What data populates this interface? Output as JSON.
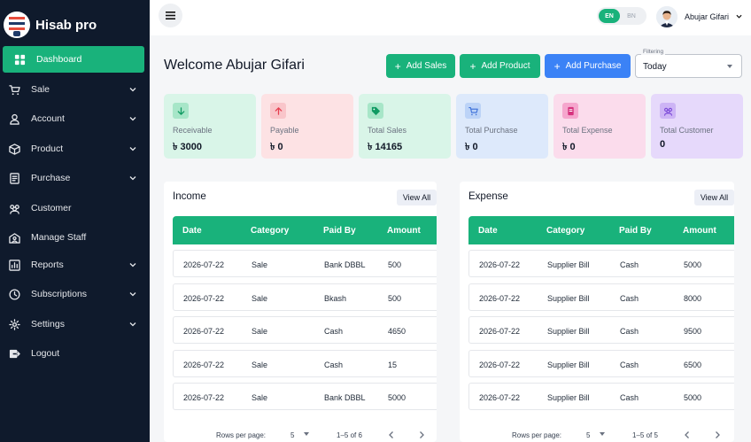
{
  "brand": {
    "name": "Hisab pro"
  },
  "sidebar": {
    "items": [
      {
        "label": "Dashboard",
        "icon": "dashboard-icon",
        "active": true,
        "has_children": false
      },
      {
        "label": "Sale",
        "icon": "cart-icon",
        "has_children": true
      },
      {
        "label": "Account",
        "icon": "user-icon",
        "has_children": true
      },
      {
        "label": "Product",
        "icon": "box-icon",
        "has_children": true
      },
      {
        "label": "Purchase",
        "icon": "receipt-icon",
        "has_children": true
      },
      {
        "label": "Customer",
        "icon": "group-icon",
        "has_children": false
      },
      {
        "label": "Manage Staff",
        "icon": "staff-icon",
        "has_children": false
      },
      {
        "label": "Reports",
        "icon": "chart-icon",
        "has_children": true
      },
      {
        "label": "Subscriptions",
        "icon": "clock-icon",
        "has_children": true
      },
      {
        "label": "Settings",
        "icon": "gear-icon",
        "has_children": true
      },
      {
        "label": "Logout",
        "icon": "logout-icon",
        "has_children": false
      }
    ]
  },
  "topbar": {
    "lang_en": "EN",
    "lang_bn": "BN",
    "user_name": "Abujar Gifari"
  },
  "header": {
    "welcome": "Welcome Abujar Gifari",
    "add_sales": "Add Sales",
    "add_product": "Add Product",
    "add_purchase": "Add Purchase",
    "filter_label": "Filtering",
    "filter_value": "Today"
  },
  "stats": [
    {
      "label": "Receivable",
      "value": "৳ 3000",
      "bg": "#d9f5e8",
      "icon_bg": "#a7e6c8",
      "icon": "arrow-down-icon",
      "icon_color": "#0f9a62"
    },
    {
      "label": "Payable",
      "value": "৳ 0",
      "bg": "#fde2e4",
      "icon_bg": "#f9c5ca",
      "icon": "arrow-up-icon",
      "icon_color": "#e53e4f"
    },
    {
      "label": "Total Sales",
      "value": "৳ 14165",
      "bg": "#d9f5e8",
      "icon_bg": "#a7e6c8",
      "icon": "tag-icon",
      "icon_color": "#0f9a62"
    },
    {
      "label": "Total Purchase",
      "value": "৳ 0",
      "bg": "#dde9fb",
      "icon_bg": "#bcd3f7",
      "icon": "cart-icon",
      "icon_color": "#3b6fd8"
    },
    {
      "label": "Total Expense",
      "value": "৳ 0",
      "bg": "#fbdcec",
      "icon_bg": "#f5a6cd",
      "icon": "wallet-icon",
      "icon_color": "#d6337e"
    },
    {
      "label": "Total Customer",
      "value": "0",
      "bg": "#e6d9fb",
      "icon_bg": "#cdb4f5",
      "icon": "group-icon",
      "icon_color": "#7c4ad8"
    }
  ],
  "income": {
    "title": "Income",
    "view_all": "View All",
    "columns": [
      "Date",
      "Category",
      "Paid By",
      "Amount"
    ],
    "rows": [
      [
        "2026-07-22",
        "Sale",
        "Bank DBBL",
        "500"
      ],
      [
        "2026-07-22",
        "Sale",
        "Bkash",
        "500"
      ],
      [
        "2026-07-22",
        "Sale",
        "Cash",
        "4650"
      ],
      [
        "2026-07-22",
        "Sale",
        "Cash",
        "15"
      ],
      [
        "2026-07-22",
        "Sale",
        "Bank DBBL",
        "5000"
      ]
    ],
    "rows_per_page_label": "Rows per page:",
    "rows_per_page": "5",
    "range": "1–5 of 6"
  },
  "expense": {
    "title": "Expense",
    "view_all": "View All",
    "columns": [
      "Date",
      "Category",
      "Paid By",
      "Amount"
    ],
    "rows": [
      [
        "2026-07-22",
        "Supplier Bill",
        "Cash",
        "5000"
      ],
      [
        "2026-07-22",
        "Supplier Bill",
        "Cash",
        "8000"
      ],
      [
        "2026-07-22",
        "Supplier Bill",
        "Cash",
        "9500"
      ],
      [
        "2026-07-22",
        "Supplier Bill",
        "Cash",
        "6500"
      ],
      [
        "2026-07-22",
        "Supplier Bill",
        "Cash",
        "5000"
      ]
    ],
    "rows_per_page_label": "Rows per page:",
    "rows_per_page": "5",
    "range": "1–5 of 5"
  },
  "colors": {
    "sidebar": "#0f1a2c",
    "accent": "#19b27b",
    "blue": "#3b82f6"
  }
}
